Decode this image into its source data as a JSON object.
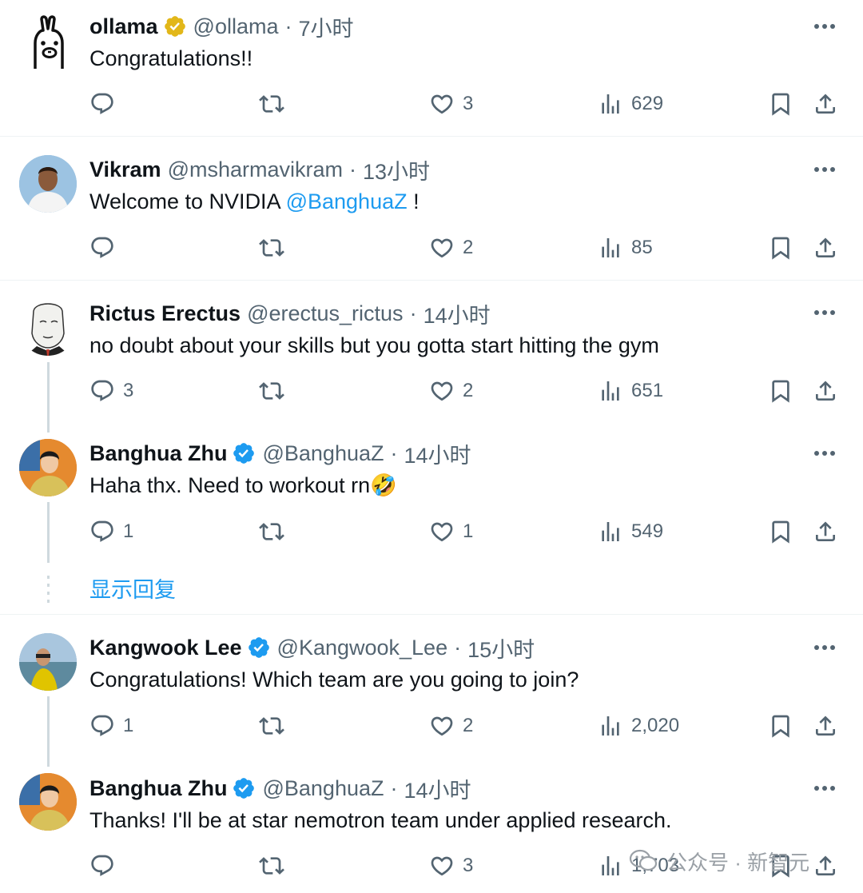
{
  "tweets": [
    {
      "name": "ollama",
      "verified": "gold",
      "handle": "@ollama",
      "time": "7小时",
      "text": "Congratulations!!",
      "replies": "",
      "retweets": "",
      "likes": "3",
      "views": "629"
    },
    {
      "name": "Vikram",
      "verified": "",
      "handle": "@msharmavikram",
      "time": "13小时",
      "text_before": "Welcome to NVIDIA ",
      "mention": "@BanghuaZ",
      "text_after": " !",
      "replies": "",
      "retweets": "",
      "likes": "2",
      "views": "85"
    },
    {
      "name": "Rictus Erectus",
      "verified": "",
      "handle": "@erectus_rictus",
      "time": "14小时",
      "text": "no doubt about your skills but you gotta start hitting the gym",
      "replies": "3",
      "retweets": "",
      "likes": "2",
      "views": "651"
    },
    {
      "name": "Banghua Zhu",
      "verified": "blue",
      "handle": "@BanghuaZ",
      "time": "14小时",
      "text": "Haha thx. Need to workout rn🤣",
      "replies": "1",
      "retweets": "",
      "likes": "1",
      "views": "549"
    },
    {
      "name": "Kangwook Lee",
      "verified": "blue",
      "handle": "@Kangwook_Lee",
      "time": "15小时",
      "text": "Congratulations!  Which team are you going to join?",
      "replies": "1",
      "retweets": "",
      "likes": "2",
      "views": "2,020"
    },
    {
      "name": "Banghua Zhu",
      "verified": "blue",
      "handle": "@BanghuaZ",
      "time": "14小时",
      "text": "Thanks! I'll be at star nemotron team under applied research.",
      "replies": "",
      "retweets": "",
      "likes": "3",
      "views": "1,703"
    }
  ],
  "show_replies": "显示回复",
  "separator": "·",
  "watermark": {
    "text": "公众号 · 新智元"
  },
  "colors": {
    "link": "#1d9bf0",
    "muted": "#536471",
    "divider": "#eff3f4",
    "verified_blue": "#1d9bf0",
    "verified_gold": "#e2b719"
  }
}
